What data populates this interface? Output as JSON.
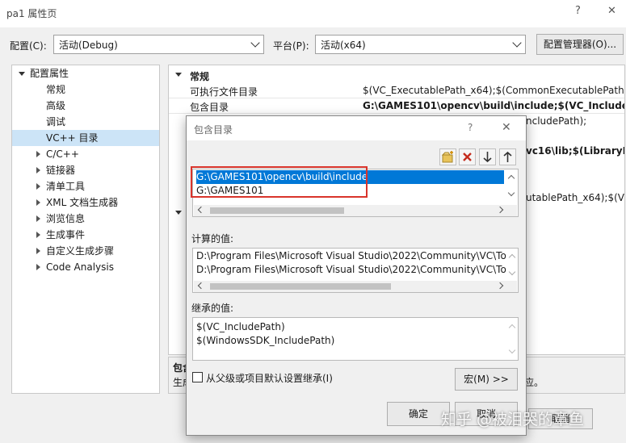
{
  "window": {
    "title": "pa1 属性页",
    "help_glyph": "?",
    "close_glyph": "✕"
  },
  "toolbar": {
    "config_label": "配置(C):",
    "config_value": "活动(Debug)",
    "platform_label": "平台(P):",
    "platform_value": "活动(x64)",
    "config_manager_label": "配置管理器(O)..."
  },
  "tree": {
    "root": "配置属性",
    "items": [
      "常规",
      "高级",
      "调试",
      "VC++ 目录",
      "C/C++",
      "链接器",
      "清单工具",
      "XML 文档生成器",
      "浏览信息",
      "生成事件",
      "自定义生成步骤",
      "Code Analysis"
    ],
    "selected_index": 3
  },
  "grid": {
    "section": "常规",
    "rows": [
      {
        "key": "可执行文件目录",
        "value": "$(VC_ExecutablePath_x64);$(CommonExecutablePath)"
      },
      {
        "key": "包含目录",
        "value": "G:\\GAMES101\\opencv\\build\\include;$(VC_IncludePat"
      }
    ],
    "peek": {
      "line1": "ncludePath);",
      "line2": "vc16\\lib;$(LibraryPa",
      "line3": "utablePath_x64);$(VC_"
    }
  },
  "description": {
    "title": "包含",
    "text_left": "生成",
    "text_right": "应。"
  },
  "dialog": {
    "title": "包含目录",
    "help_glyph": "?",
    "close_glyph": "✕",
    "entries": [
      "G:\\GAMES101\\opencv\\build\\include",
      "G:\\GAMES101"
    ],
    "computed_label": "计算的值:",
    "computed": [
      "D:\\Program Files\\Microsoft Visual Studio\\2022\\Community\\VC\\To",
      "D:\\Program Files\\Microsoft Visual Studio\\2022\\Community\\VC\\To"
    ],
    "inherited_label": "继承的值:",
    "inherited": [
      "$(VC_IncludePath)",
      "$(WindowsSDK_IncludePath)"
    ],
    "inherit_checkbox_label": "从父级或项目默认设置继承(I)",
    "macros_label": "宏(M) >>",
    "ok_label": "确定",
    "cancel_label": "取消"
  },
  "main_buttons": {
    "cancel_label": "取消"
  },
  "watermark": "知乎 @被泪哭的章鱼",
  "colors": {
    "selection": "#0078d7",
    "tree_selection": "#cce4f7",
    "highlight": "#d9342b",
    "delete": "#c42b1c"
  }
}
